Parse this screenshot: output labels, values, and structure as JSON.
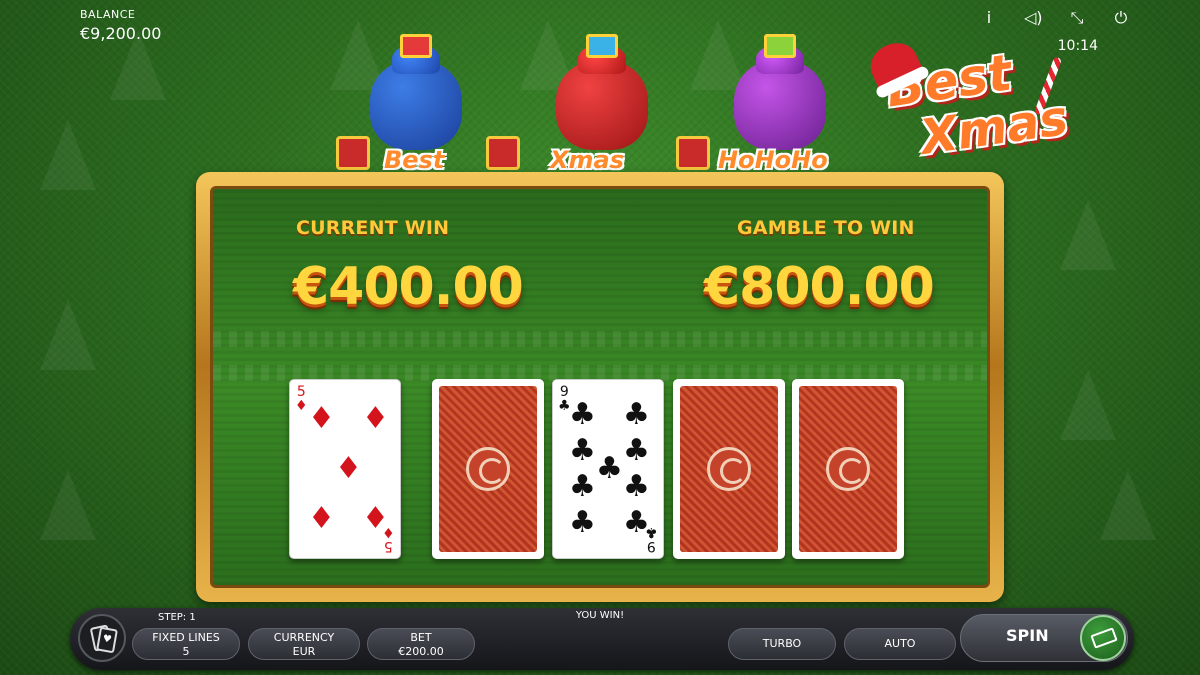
{
  "header": {
    "balance_label": "BALANCE",
    "balance_value": "€9,200.00",
    "time": "10:14",
    "icons": [
      "info-icon",
      "sound-icon",
      "fullscreen-exit-icon",
      "power-icon"
    ],
    "info_glyph": "i",
    "sound_glyph": "◁)",
    "fullscreen_glyph": "⤡",
    "power_glyph": "⏻"
  },
  "logo": {
    "line1": "Best",
    "line2": "Xmas"
  },
  "sacks": {
    "labels": [
      "Best",
      "Xmas",
      "HoHoHo"
    ]
  },
  "gamble": {
    "current_win_label": "CURRENT WIN",
    "current_win_value": "€400.00",
    "gamble_to_win_label": "GAMBLE TO WIN",
    "gamble_to_win_value": "€800.00"
  },
  "cards": [
    {
      "state": "face-up",
      "rank": "5",
      "suit": "diamonds",
      "suit_glyph": "♦",
      "color": "red"
    },
    {
      "state": "face-down"
    },
    {
      "state": "face-up",
      "rank": "9",
      "suit": "clubs",
      "suit_glyph": "♣",
      "color": "black"
    },
    {
      "state": "face-down"
    },
    {
      "state": "face-down"
    }
  ],
  "bottom_bar": {
    "step": "STEP: 1",
    "status": "YOU WIN!",
    "fixed_lines_label": "FIXED LINES",
    "fixed_lines_value": "5",
    "currency_label": "CURRENCY",
    "currency_value": "EUR",
    "bet_label": "BET",
    "bet_value": "€200.00",
    "turbo_label": "TURBO",
    "auto_label": "AUTO",
    "spin_label": "SPIN"
  },
  "colors": {
    "background_green": "#2c6d1f",
    "gold_text": "#ffc93a",
    "frame_gold": "#e8b34a",
    "card_red": "#d4141c"
  }
}
